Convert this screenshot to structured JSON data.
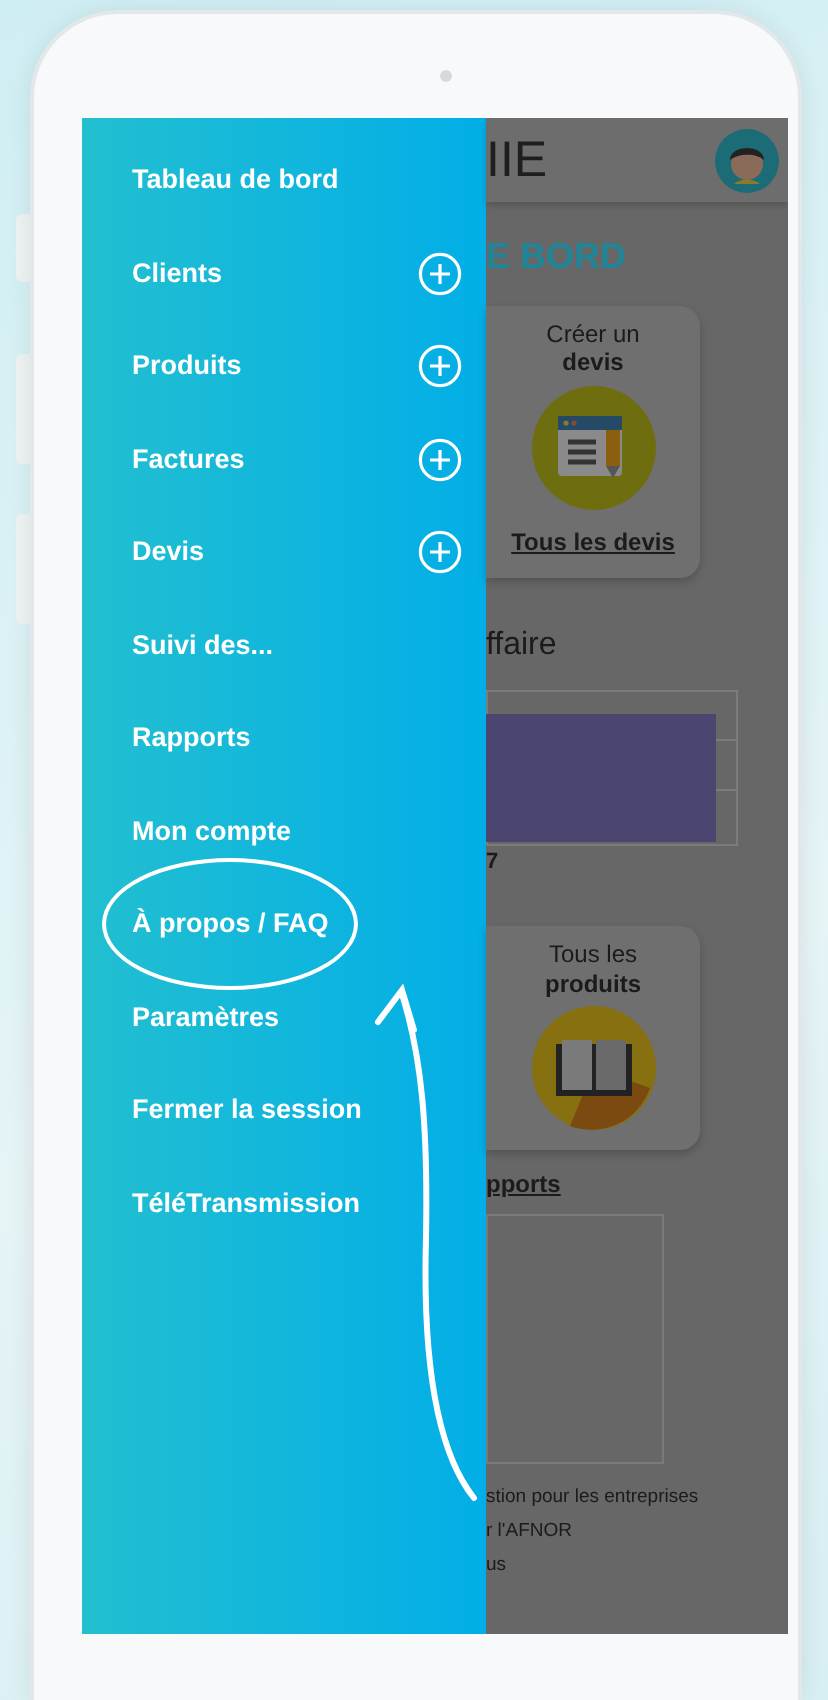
{
  "menu": {
    "items": [
      {
        "label": "Tableau de bord",
        "expandable": false,
        "circled": false
      },
      {
        "label": "Clients",
        "expandable": true,
        "circled": false
      },
      {
        "label": "Produits",
        "expandable": true,
        "circled": false
      },
      {
        "label": "Factures",
        "expandable": true,
        "circled": false
      },
      {
        "label": "Devis",
        "expandable": true,
        "circled": false
      },
      {
        "label": "Suivi des...",
        "expandable": false,
        "circled": false
      },
      {
        "label": "Rapports",
        "expandable": false,
        "circled": false
      },
      {
        "label": "Mon compte",
        "expandable": false,
        "circled": false
      },
      {
        "label": "À propos / FAQ",
        "expandable": false,
        "circled": true
      },
      {
        "label": "Paramètres",
        "expandable": false,
        "circled": false
      },
      {
        "label": "Fermer la session",
        "expandable": false,
        "circled": false
      },
      {
        "label": "TéléTransmission",
        "expandable": false,
        "circled": false
      }
    ]
  },
  "app": {
    "header_title": "IIE",
    "section_title": "E BORD",
    "cards": [
      {
        "line1": "Créer un",
        "line2": "devis",
        "kind": "document",
        "link": "Tous les devis"
      },
      {
        "line1": "Tous les",
        "line2": "produits",
        "kind": "book"
      }
    ],
    "chart_heading": "ffaire",
    "chart_label": "7",
    "reports_link": "pports",
    "footer_lines": [
      "stion pour les entreprises",
      "r l'AFNOR",
      "us"
    ]
  }
}
